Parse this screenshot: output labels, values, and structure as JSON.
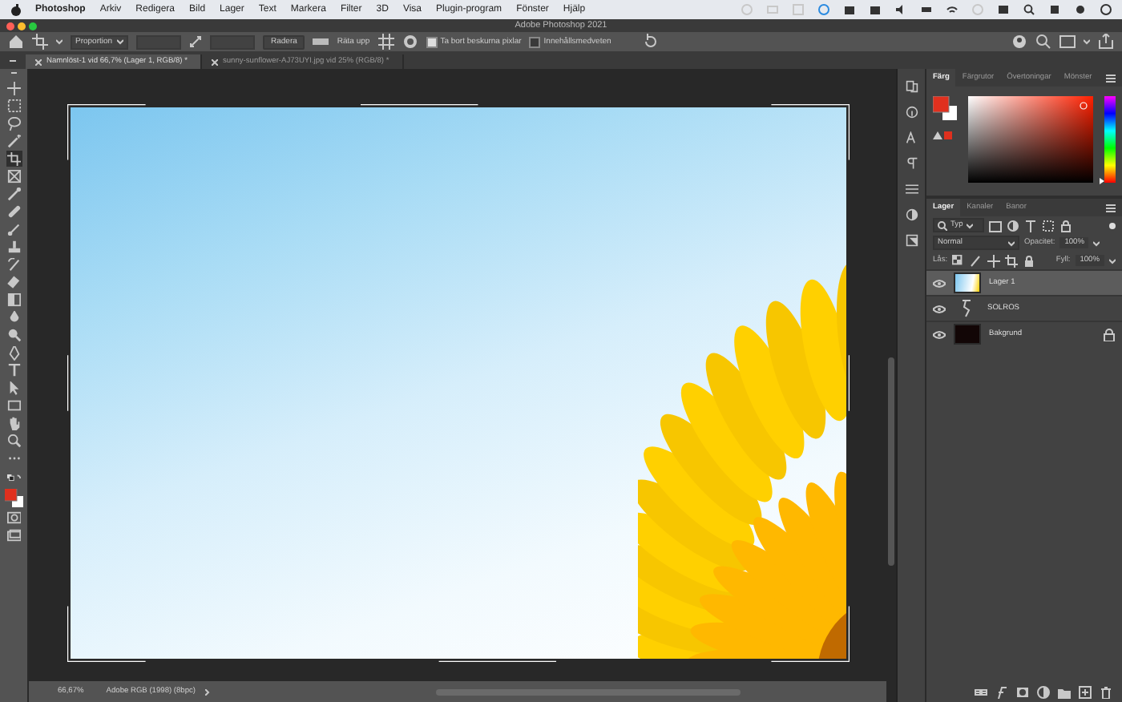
{
  "menu_bar": {
    "app": "Photoshop",
    "items": [
      "Arkiv",
      "Redigera",
      "Bild",
      "Lager",
      "Text",
      "Markera",
      "Filter",
      "3D",
      "Visa",
      "Plugin-program",
      "Fönster",
      "Hjälp"
    ]
  },
  "window": {
    "title": "Adobe Photoshop 2021"
  },
  "options_bar": {
    "ratio": "Proportion",
    "clear_button": "Radera",
    "straighten_button": "Räta upp",
    "checkboxes": [
      {
        "label": "Ta bort beskurna pixlar",
        "checked": true
      },
      {
        "label": "Innehållsmedveten",
        "checked": false
      }
    ]
  },
  "document_tabs": [
    {
      "label": "Namnlöst-1 vid 66,7% (Lager 1, RGB/8) *",
      "selected": true
    },
    {
      "label": "sunny-sunflower-AJ73UYI.jpg vid 25% (RGB/8) *",
      "selected": false
    }
  ],
  "color_panel": {
    "hue_slider": {
      "level": 0.02
    },
    "tabs": [
      {
        "label": "Färg",
        "selected": true
      },
      {
        "label": "Färgrutor",
        "selected": false
      },
      {
        "label": "Övertoningar",
        "selected": false
      },
      {
        "label": "Mönster",
        "selected": false
      }
    ]
  },
  "layers_panel": {
    "tabs": [
      {
        "label": "Lager",
        "selected": true
      },
      {
        "label": "Kanaler",
        "selected": false
      },
      {
        "label": "Banor",
        "selected": false
      }
    ],
    "filter": "Typ",
    "blend_mode": "Normal",
    "opacity_label": "Opacitet:",
    "opacity": "100%",
    "lock_label": "Lås:",
    "fill_label": "Fyll:",
    "fill": "100%",
    "layers": [
      {
        "name": "Lager 1",
        "kind": "image",
        "selected": true,
        "locked": false
      },
      {
        "name": "SOLROS",
        "kind": "symbol",
        "selected": false,
        "locked": false
      },
      {
        "name": "Bakgrund",
        "kind": "fill",
        "selected": false,
        "locked": true
      }
    ]
  },
  "status_bar": {
    "zoom": "66,67%",
    "profile": "Adobe RGB (1998) (8bpc)"
  }
}
